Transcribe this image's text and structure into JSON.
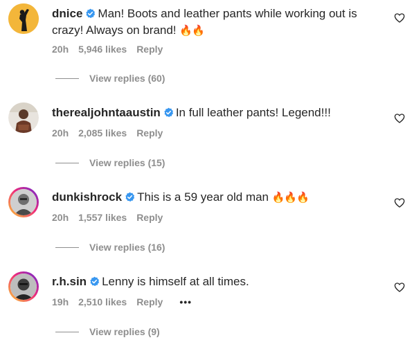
{
  "comments": [
    {
      "username": "dnice",
      "text_line1": "Man! Boots and leather pants while working out is",
      "text_line2": "crazy! Always on brand!",
      "emoji": "🔥🔥",
      "time": "20h",
      "likes": "5,946 likes",
      "reply": "Reply",
      "view_replies": "View replies (60)",
      "avatar_icon": "silhouette-raised-arm-icon",
      "avatar_bg": "#f3b63a"
    },
    {
      "username": "therealjohntaaustin",
      "text": "In full leather pants! Legend!!!",
      "emoji": "",
      "time": "20h",
      "likes": "2,085 likes",
      "reply": "Reply",
      "view_replies": "View replies (15)",
      "avatar_icon": "person-photo-icon"
    },
    {
      "username": "dunkishrock",
      "text": "This is a 59 year old man",
      "emoji": "🔥🔥🔥",
      "time": "20h",
      "likes": "1,557 likes",
      "reply": "Reply",
      "view_replies": "View replies (16)",
      "avatar_icon": "person-photo-icon"
    },
    {
      "username": "r.h.sin",
      "text": "Lenny is himself at all times.",
      "emoji": "",
      "time": "19h",
      "likes": "2,510 likes",
      "reply": "Reply",
      "more": "•••",
      "view_replies": "View replies (9)",
      "avatar_icon": "person-photo-icon"
    }
  ],
  "colors": {
    "text": "#262626",
    "secondary": "#8e8e8e",
    "verified": "#3897f0",
    "story_ring_start": "#f9ce34",
    "story_ring_end": "#6228d7"
  }
}
